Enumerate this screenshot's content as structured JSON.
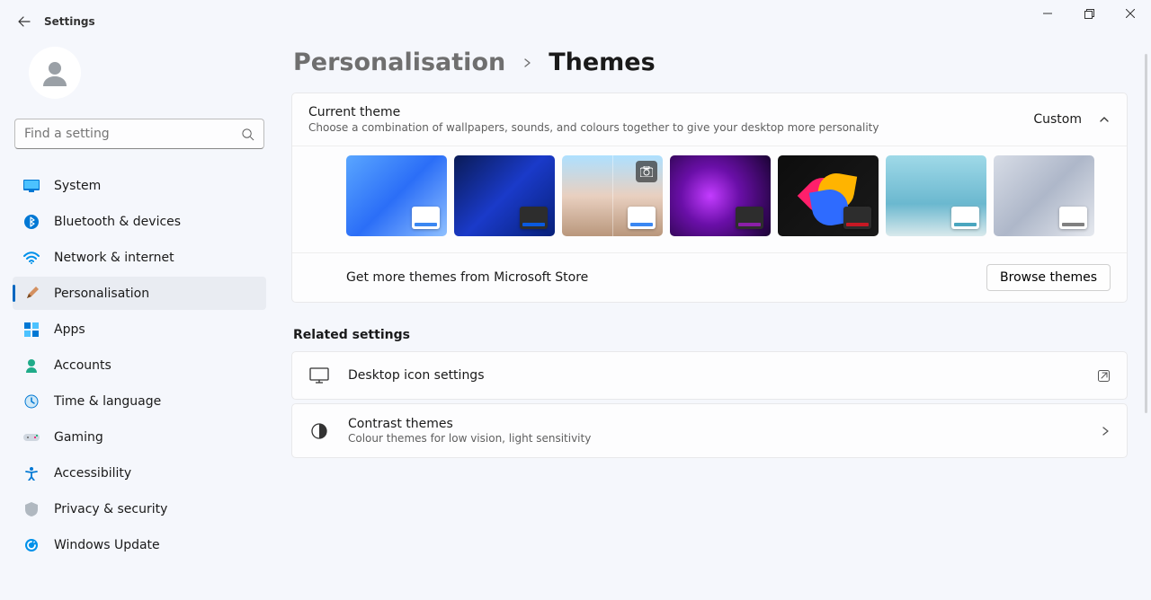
{
  "app_title": "Settings",
  "search_placeholder": "Find a setting",
  "nav_items": [
    {
      "label": "System",
      "icon": "system"
    },
    {
      "label": "Bluetooth & devices",
      "icon": "bluetooth"
    },
    {
      "label": "Network & internet",
      "icon": "wifi"
    },
    {
      "label": "Personalisation",
      "icon": "brush"
    },
    {
      "label": "Apps",
      "icon": "apps"
    },
    {
      "label": "Accounts",
      "icon": "accounts"
    },
    {
      "label": "Time & language",
      "icon": "time"
    },
    {
      "label": "Gaming",
      "icon": "gaming"
    },
    {
      "label": "Accessibility",
      "icon": "accessibility"
    },
    {
      "label": "Privacy & security",
      "icon": "privacy"
    },
    {
      "label": "Windows Update",
      "icon": "update"
    }
  ],
  "nav_active_index": 3,
  "breadcrumb": {
    "parent": "Personalisation",
    "current": "Themes"
  },
  "current_theme": {
    "title": "Current theme",
    "desc": "Choose a combination of wallpapers, sounds, and colours together to give your desktop more personality",
    "value": "Custom"
  },
  "themes": [
    {
      "id": "windows-light",
      "swatch": "#3a87f2",
      "swatch_bg": "light"
    },
    {
      "id": "windows-dark",
      "swatch": "#0a5adf",
      "swatch_bg": "dark"
    },
    {
      "id": "spotlight",
      "swatch": "#3a87f2",
      "swatch_bg": "light",
      "camera": true
    },
    {
      "id": "glow",
      "swatch": "#8b1fa9",
      "swatch_bg": "dark"
    },
    {
      "id": "flow",
      "swatch": "#c61824",
      "swatch_bg": "dark"
    },
    {
      "id": "captured-motion",
      "swatch": "#4aa6bf",
      "swatch_bg": "light"
    },
    {
      "id": "sunrise",
      "swatch": "#808080",
      "swatch_bg": "light"
    }
  ],
  "store": {
    "text": "Get more themes from Microsoft Store",
    "button": "Browse themes"
  },
  "related_title": "Related settings",
  "related": [
    {
      "title": "Desktop icon settings",
      "desc": "",
      "icon": "desktop",
      "action": "external"
    },
    {
      "title": "Contrast themes",
      "desc": "Colour themes for low vision, light sensitivity",
      "icon": "contrast",
      "action": "chevron"
    }
  ]
}
